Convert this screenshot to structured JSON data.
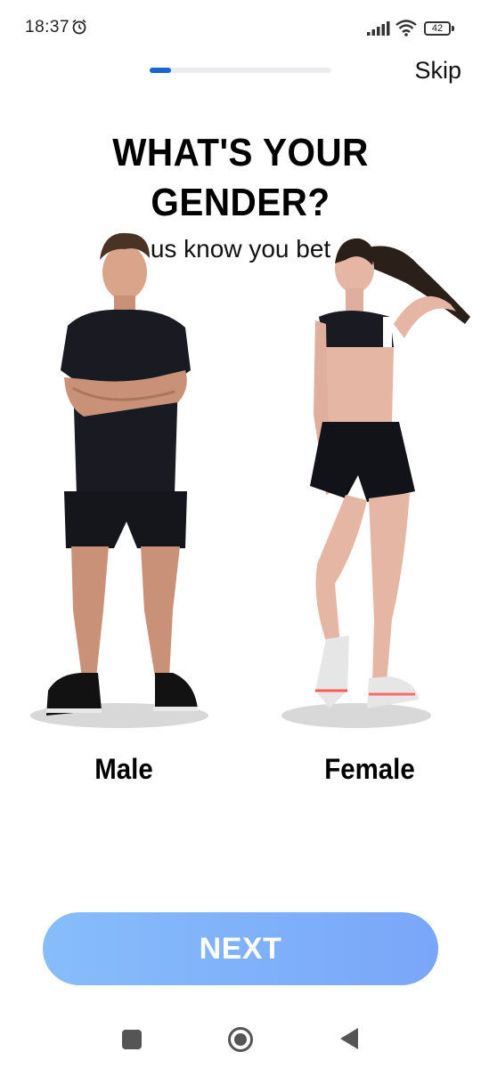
{
  "status_bar": {
    "time": "18:37",
    "battery": "42",
    "icons": [
      "alarm-icon",
      "signal-icon",
      "wifi-icon",
      "battery-icon"
    ]
  },
  "onboarding": {
    "progress_fraction": 0.12,
    "skip_label": "Skip"
  },
  "header": {
    "title_line1": "WHAT'S YOUR",
    "title_line2": "GENDER?",
    "subtitle": "us know you bet"
  },
  "options": [
    {
      "label": "Male"
    },
    {
      "label": "Female"
    }
  ],
  "next_label": "NEXT",
  "nav_bar": {
    "icons": [
      "recent-apps-icon",
      "home-icon",
      "back-icon"
    ]
  },
  "colors": {
    "progress": "#1766d6",
    "button_start": "#86bdfb",
    "button_end": "#7aa6f9"
  }
}
